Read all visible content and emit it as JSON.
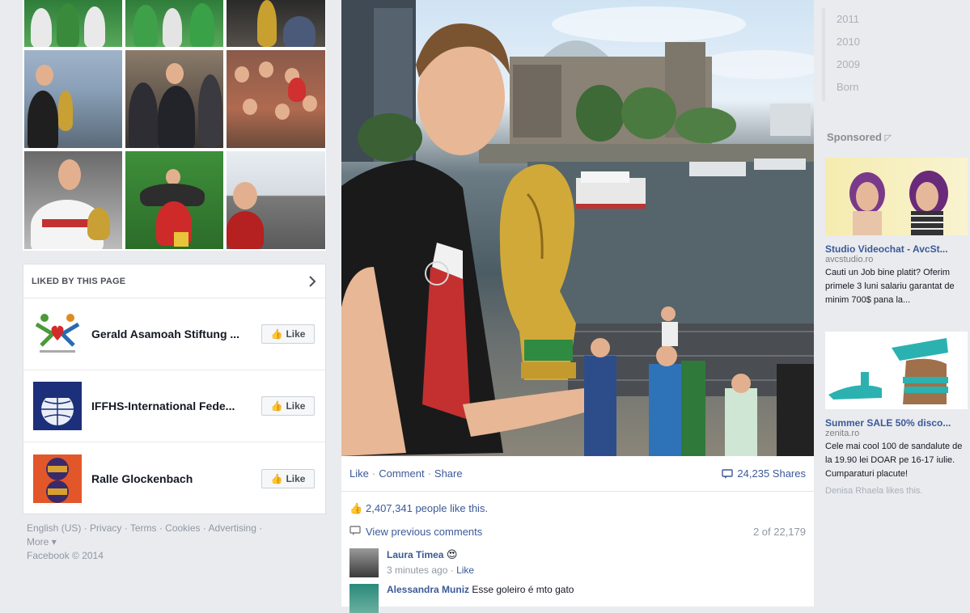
{
  "liked_by": {
    "title": "LIKED BY THIS PAGE",
    "pages": [
      {
        "name": "Gerald Asamoah Stiftung ...",
        "button": "Like"
      },
      {
        "name": "IFFHS-International Fede...",
        "button": "Like"
      },
      {
        "name": "Ralle Glockenbach",
        "button": "Like"
      }
    ]
  },
  "footer": {
    "links": [
      "English (US)",
      "Privacy",
      "Terms",
      "Cookies",
      "Advertising",
      "More"
    ],
    "copyright": "Facebook © 2014"
  },
  "post": {
    "actions": {
      "like": "Like",
      "comment": "Comment",
      "share": "Share"
    },
    "shares": "24,235 Shares",
    "likes_text": "2,407,341 people like this.",
    "view_previous": "View previous comments",
    "pager": "2 of 22,179",
    "comments": [
      {
        "author": "Laura Timea",
        "text": "",
        "time": "3 minutes ago",
        "like": "Like"
      },
      {
        "author": "Alessandra Muniz",
        "text": "Esse goleiro é mto gato",
        "time": "",
        "like": ""
      }
    ]
  },
  "timeline": {
    "years": [
      "2011",
      "2010",
      "2009",
      "Born"
    ]
  },
  "sponsored": {
    "title": "Sponsored",
    "ads": [
      {
        "title": "Studio Videochat - AvcSt...",
        "domain": "avcstudio.ro",
        "body": "Cauti un Job bine platit? Oferim primele 3 luni salariu garantat de minim 700$ pana la..."
      },
      {
        "title": "Summer SALE 50% disco...",
        "domain": "zenita.ro",
        "body": "Cele mai cool 100 de sandalute de la 19.90 lei DOAR pe 16-17 iulie. Cumparaturi placute!",
        "social": "Denisa Rhaela likes this."
      }
    ]
  },
  "colors": {
    "link": "#3b5998",
    "background": "#e9ebee"
  }
}
